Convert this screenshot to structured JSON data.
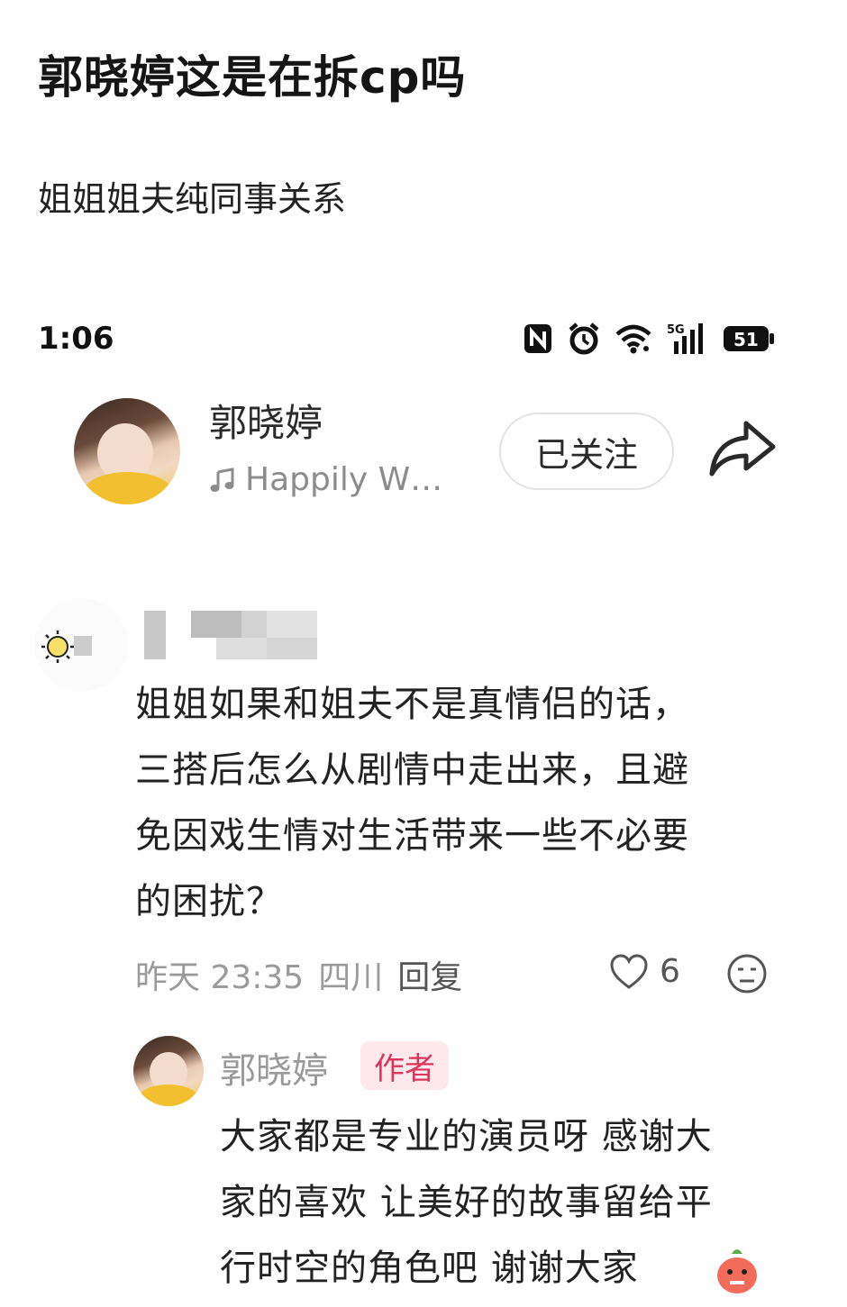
{
  "post": {
    "title": "郭晓婷这是在拆cp吗",
    "subtitle": "姐姐姐夫纯同事关系"
  },
  "status_bar": {
    "time": "1:06",
    "network": "5G",
    "battery": "51",
    "icons": [
      "nfc-icon",
      "alarm-icon",
      "wifi-icon",
      "signal-icon",
      "battery-icon"
    ]
  },
  "profile": {
    "name": "郭晓婷",
    "music": "Happily W…",
    "follow_label": "已关注"
  },
  "comment": {
    "lines": [
      "姐姐如果和姐夫不是真情侣的话，",
      "三搭后怎么从剧情中走出来，且避",
      "免因戏生情对生活带来一些不必要",
      "的困扰？"
    ],
    "time": "昨天 23:35",
    "location": "四川",
    "reply_label": "回复",
    "likes": "6"
  },
  "reply": {
    "name": "郭晓婷",
    "badge": "作者",
    "lines": [
      "大家都是专业的演员呀 感谢大",
      "家的喜欢 让美好的故事留给平",
      "行时空的角色吧 谢谢大家"
    ]
  },
  "colors": {
    "badge_text": "#d9365a",
    "badge_bg": "#fde8ec",
    "meta": "#9a9a9a"
  }
}
